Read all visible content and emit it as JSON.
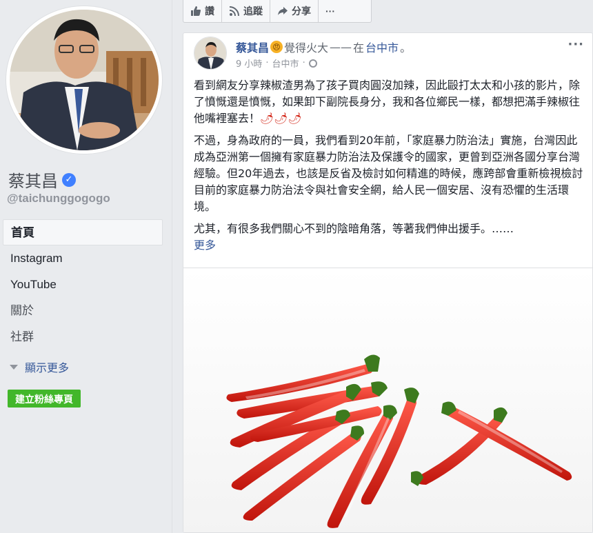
{
  "page": {
    "name": "蔡其昌",
    "verified_mark": "✓",
    "handle": "@taichunggogogo"
  },
  "nav": {
    "items": [
      {
        "label": "首頁"
      },
      {
        "label": "Instagram"
      },
      {
        "label": "YouTube"
      },
      {
        "label": "關於"
      },
      {
        "label": "社群"
      }
    ],
    "more_label": "顯示更多",
    "create_page": "建立粉絲專頁"
  },
  "actions": {
    "like": "讚",
    "follow": "追蹤",
    "share": "分享",
    "more": "···"
  },
  "post": {
    "author": "蔡其昌",
    "feeling_emoji": "😠",
    "feeling": "覺得火大",
    "dash": "——",
    "at": "在",
    "place": "台中市",
    "period": "。",
    "time": "9 小時",
    "location": "台中市",
    "menu": "···",
    "paragraphs": [
      "看到網友分享辣椒渣男為了孩子買肉圓沒加辣，因此毆打太太和小孩的影片，除了憤慨還是憤慨，如果卸下副院長身分，我和各位鄉民一樣，都想把滿手辣椒往他嘴裡塞去！",
      "不過，身為政府的一員，我們看到20年前，「家庭暴力防治法」實施，台灣因此成為亞洲第一個擁有家庭暴力防治法及保護令的國家，更曾到亞洲各國分享台灣經驗。但20年過去，也該是反省及檢討如何精進的時候，應跨部會重新檢視檢討目前的家庭暴力防治法令與社會安全網，給人民一個安居、沒有恐懼的生活環境。",
      "尤其，有很多我們關心不到的陰暗角落，等著我們伸出援手。……"
    ],
    "chili_emojis": "🌶🌶🌶",
    "see_more": "更多"
  },
  "colors": {
    "link": "#365899",
    "green": "#42b72a",
    "chili_red": "#d42c1e"
  }
}
